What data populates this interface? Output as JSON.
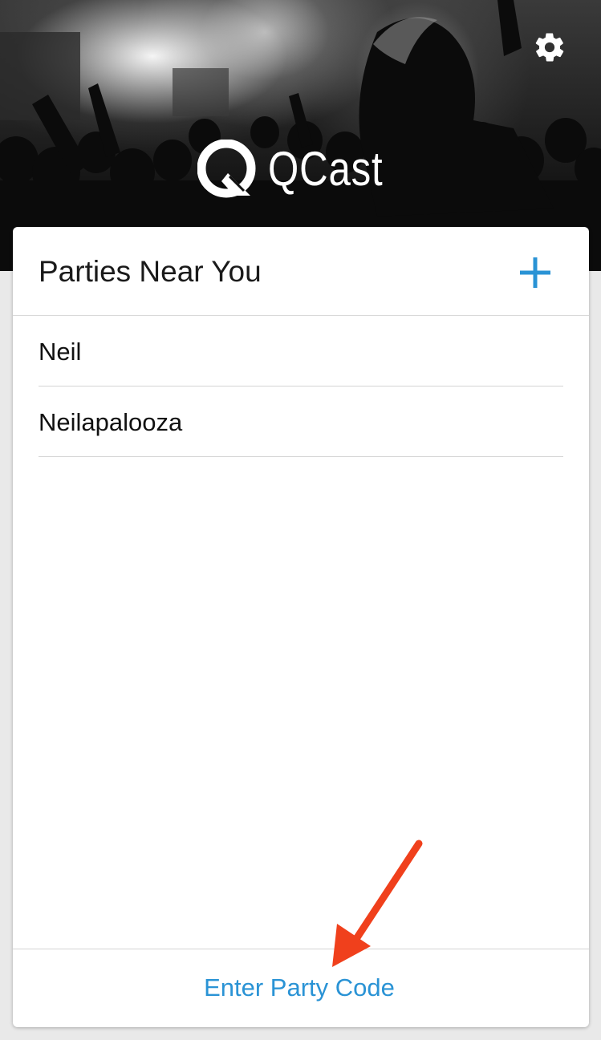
{
  "app": {
    "name": "QCast"
  },
  "header": {
    "settings_icon": "gear-icon",
    "logo_icon": "qcast-logo-icon"
  },
  "card": {
    "title": "Parties Near You",
    "add_icon": "plus-icon",
    "add_color": "#2a93d5",
    "parties": [
      {
        "label": "Neil"
      },
      {
        "label": "Neilapalooza"
      }
    ],
    "footer_link": "Enter Party Code",
    "link_color": "#2a93d5"
  },
  "annotation": {
    "icon": "arrow-icon",
    "color": "#f0401c"
  }
}
